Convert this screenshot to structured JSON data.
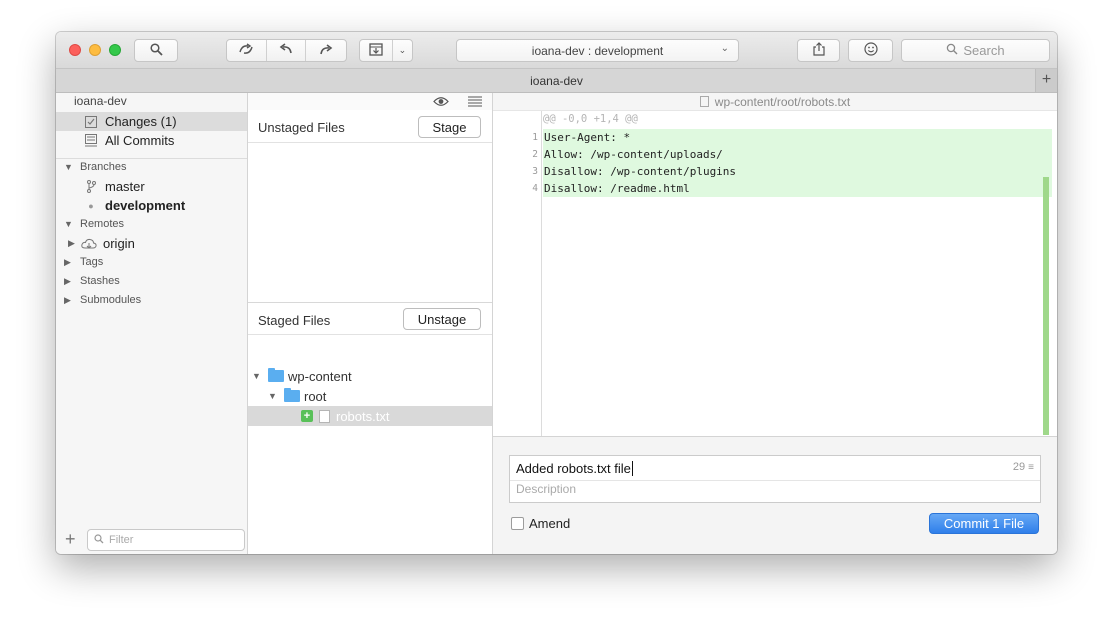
{
  "toolbar": {
    "branch_selector": "ioana-dev :  development",
    "search_placeholder": "Search"
  },
  "tab": {
    "title": "ioana-dev"
  },
  "sidebar": {
    "repo": "ioana-dev",
    "workspace": [
      {
        "label": "Changes (1)",
        "icon": "changes-icon",
        "selected": true
      },
      {
        "label": "All Commits",
        "icon": "commits-icon",
        "selected": false
      }
    ],
    "branches_header": "Branches",
    "branches": [
      {
        "label": "master",
        "current": false
      },
      {
        "label": "development",
        "current": true
      }
    ],
    "remotes_header": "Remotes",
    "remotes": [
      {
        "label": "origin"
      }
    ],
    "tags_header": "Tags",
    "stashes_header": "Stashes",
    "submodules_header": "Submodules",
    "filter_placeholder": "Filter"
  },
  "files": {
    "unstaged_title": "Unstaged Files",
    "stage_button": "Stage",
    "staged_title": "Staged Files",
    "unstage_button": "Unstage",
    "tree": [
      {
        "label": "wp-content",
        "level": 0,
        "type": "folder"
      },
      {
        "label": "root",
        "level": 1,
        "type": "folder"
      },
      {
        "label": "robots.txt",
        "level": 2,
        "type": "file",
        "status": "added",
        "selected": true
      }
    ]
  },
  "diff": {
    "file_path": "wp-content/root/robots.txt",
    "hunk_header": "@@ -0,0 +1,4 @@",
    "lines": [
      {
        "num": "1",
        "text": "User-Agent: *"
      },
      {
        "num": "2",
        "text": "Allow: /wp-content/uploads/"
      },
      {
        "num": "3",
        "text": "Disallow: /wp-content/plugins"
      },
      {
        "num": "4",
        "text": "Disallow: /readme.html"
      }
    ]
  },
  "commit": {
    "title": "Added robots.txt file",
    "char_count": "29",
    "description_placeholder": "Description",
    "amend_label": "Amend",
    "amend_checked": false,
    "commit_button": "Commit 1 File"
  },
  "colors": {
    "accent": "#2f7fea",
    "added_bg": "#dff9df",
    "added_badge": "#58c058",
    "folder": "#5aaef0"
  }
}
